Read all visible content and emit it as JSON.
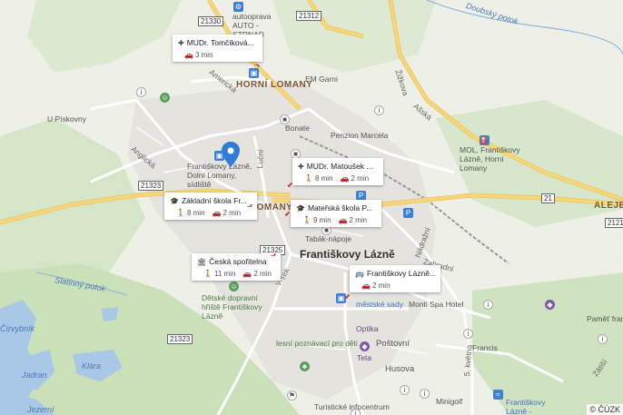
{
  "map": {
    "copyright": "© ČÚZK"
  },
  "places": {
    "town_main": "Františkovy Lázně",
    "horni_lomany": "HORNÍ LOMANY",
    "lomany": "LOMANY",
    "aleje": "ALEJE-",
    "bonate": "Bonate",
    "em_garni": "EM Garni",
    "penzion": "Penzion Marcela",
    "mol": "MOL, Františkovy Lázně, Horní Lomany",
    "sidliste": "Františkovy Lázně, Dolní Lomany, sídliště",
    "tabak": "Tabák-nápoje",
    "detske": "Dětské dopravní hřiště Františkovy Lázně",
    "lesni": "lesní poznávací pro děti",
    "postovni": "Poštovní",
    "husova": "Husova",
    "optika": "Optika",
    "teta": "Teta",
    "mestske_sady": "městské sady",
    "monti": "Monti Spa Hotel",
    "francis": "Francis",
    "pamet": "Paměť franti",
    "minigolf": "Minigolf",
    "turisticke": "Turistické infocentrum",
    "aquaforum": "Františkovy Lázně - Aquaforum",
    "autoprav": "autooprava AUTO - STRNAD",
    "cirvybnik": "Čírvybník",
    "jadran": "Jadran",
    "klara": "Klára",
    "jezerni": "Jezerní",
    "slatinny": "Slatinný potok",
    "doubsky": "Doubský potok",
    "u_piskovny": "U Pískovny"
  },
  "streets": {
    "americka": "Americká",
    "anglicka": "Anglická",
    "zizkova": "Žižkova",
    "asska": "Ašská",
    "lucni": "Luční",
    "nadrazni": "Nádražní",
    "zahradni": "Zahradní",
    "petkvetna": "5. května",
    "zatisi": "Zátiší",
    "vrsek": "Vršek"
  },
  "shields": {
    "r21330": "21330",
    "r21312": "21312",
    "r21323": "21323",
    "r21": "21",
    "r2121": "2121",
    "r21325": "21325",
    "r21323b": "21323"
  },
  "cards": [
    {
      "title": "MUDr. Tomčíková...",
      "walk": "",
      "car": "3 min"
    },
    {
      "title": "MUDr. Matoušek ...",
      "walk": "8 min",
      "car": "2 min"
    },
    {
      "title": "Základní škola Fr...",
      "walk": "8 min",
      "car": "2 min"
    },
    {
      "title": "Mateřská škola P...",
      "walk": "9 min",
      "car": "2 min"
    },
    {
      "title": "Česká spořitelna",
      "walk": "11 min",
      "car": "2 min"
    },
    {
      "title": "Františkovy Lázně...",
      "walk": "",
      "car": "2 min"
    }
  ],
  "colors": {
    "background": "#eef0e8",
    "forest": "#cfe3c1",
    "water": "#a9c8e8",
    "road_major": "#f7d67a",
    "road_minor": "#ffffff",
    "urban": "#e3e1dc",
    "marker": "#2f7bd6"
  },
  "icons": {
    "marker": "map-pin-icon",
    "doctor": "medical-cross-icon",
    "school": "graduation-cap-icon",
    "bank": "bank-icon",
    "bus": "bus-icon",
    "walk": "walking-icon",
    "car": "car-icon"
  }
}
